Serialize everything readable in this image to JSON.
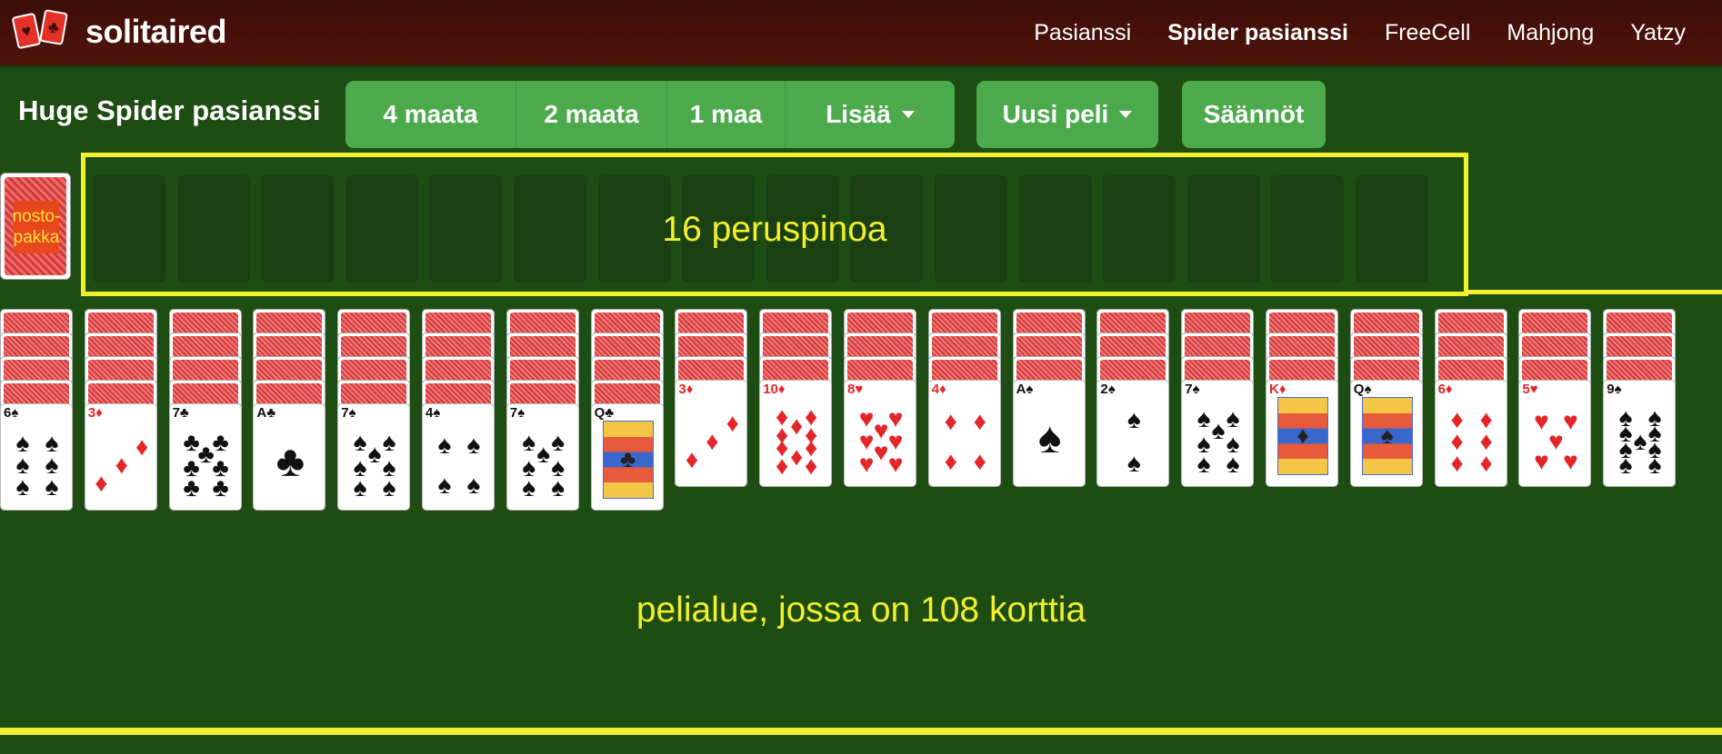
{
  "header": {
    "logo_text": "solitaired",
    "nav": [
      "Pasianssi",
      "Spider pasianssi",
      "FreeCell",
      "Mahjong",
      "Yatzy"
    ],
    "active_nav_index": 1
  },
  "toolbar": {
    "title": "Huge Spider pasianssi",
    "suit_buttons": [
      "4 maata",
      "2 maata",
      "1 maa",
      "Lisää"
    ],
    "new_game": "Uusi peli",
    "rules": "Säännöt",
    "button_color": "#4caa4c"
  },
  "stock": {
    "label": "nosto-\npakka"
  },
  "foundations": {
    "count": 16,
    "label": "16 peruspinoa"
  },
  "play_area": {
    "label": "pelialue, jossa on 108 korttia"
  },
  "colors": {
    "background": "#1d4d12",
    "header": "#3d0d07",
    "annotation": "#f1ef2e",
    "red_suit": "#e42529",
    "card_back": "#d33a3a"
  },
  "tableau": [
    {
      "face_down": 4,
      "card": {
        "rank": "6",
        "suit": "♠",
        "color": "black"
      }
    },
    {
      "face_down": 4,
      "card": {
        "rank": "3",
        "suit": "♦",
        "color": "red"
      }
    },
    {
      "face_down": 4,
      "card": {
        "rank": "7",
        "suit": "♣",
        "color": "black"
      }
    },
    {
      "face_down": 4,
      "card": {
        "rank": "A",
        "suit": "♣",
        "color": "black"
      }
    },
    {
      "face_down": 4,
      "card": {
        "rank": "7",
        "suit": "♠",
        "color": "black"
      }
    },
    {
      "face_down": 4,
      "card": {
        "rank": "4",
        "suit": "♠",
        "color": "black"
      }
    },
    {
      "face_down": 4,
      "card": {
        "rank": "7",
        "suit": "♠",
        "color": "black"
      }
    },
    {
      "face_down": 4,
      "card": {
        "rank": "Q",
        "suit": "♣",
        "color": "black"
      }
    },
    {
      "face_down": 3,
      "card": {
        "rank": "3",
        "suit": "♦",
        "color": "red"
      }
    },
    {
      "face_down": 3,
      "card": {
        "rank": "10",
        "suit": "♦",
        "color": "red"
      }
    },
    {
      "face_down": 3,
      "card": {
        "rank": "8",
        "suit": "♥",
        "color": "red"
      }
    },
    {
      "face_down": 3,
      "card": {
        "rank": "4",
        "suit": "♦",
        "color": "red"
      }
    },
    {
      "face_down": 3,
      "card": {
        "rank": "A",
        "suit": "♠",
        "color": "black"
      }
    },
    {
      "face_down": 3,
      "card": {
        "rank": "2",
        "suit": "♠",
        "color": "black"
      }
    },
    {
      "face_down": 3,
      "card": {
        "rank": "7",
        "suit": "♠",
        "color": "black"
      }
    },
    {
      "face_down": 3,
      "card": {
        "rank": "K",
        "suit": "♦",
        "color": "red"
      }
    },
    {
      "face_down": 3,
      "card": {
        "rank": "Q",
        "suit": "♠",
        "color": "black"
      }
    },
    {
      "face_down": 3,
      "card": {
        "rank": "6",
        "suit": "♦",
        "color": "red"
      }
    },
    {
      "face_down": 3,
      "card": {
        "rank": "5",
        "suit": "♥",
        "color": "red"
      }
    },
    {
      "face_down": 3,
      "card": {
        "rank": "9",
        "suit": "♠",
        "color": "black"
      }
    }
  ]
}
